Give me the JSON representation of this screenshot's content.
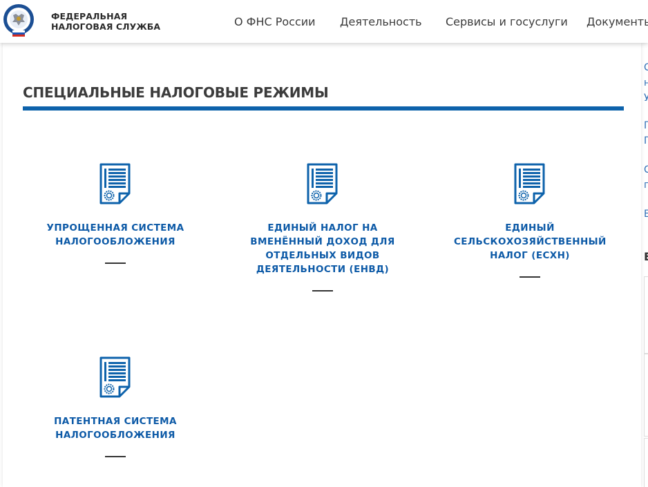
{
  "header": {
    "brand_line1": "ФЕДЕРАЛЬНАЯ",
    "brand_line2": "НАЛОГОВАЯ СЛУЖБА",
    "nav": [
      "О ФНС России",
      "Деятельность",
      "Сервисы и госуслуги",
      "Документы"
    ]
  },
  "main": {
    "title": "СПЕЦИАЛЬНЫЕ НАЛОГОВЫЕ РЕЖИМЫ",
    "cards": [
      {
        "label": "УПРОЩЕННАЯ СИСТЕМА НАЛОГООБЛОЖЕНИЯ"
      },
      {
        "label": "ЕДИНЫЙ НАЛОГ НА ВМЕНЁННЫЙ ДОХОД ДЛЯ ОТДЕЛЬНЫХ ВИДОВ ДЕЯТЕЛЬНОСТИ (ЕНВД)"
      },
      {
        "label": "ЕДИНЫЙ СЕЛЬСКОХОЗЯЙСТВЕННЫЙ НАЛОГ (ЕСХН)"
      },
      {
        "label": "ПАТЕНТНАЯ СИСТЕМА НАЛОГООБЛОЖЕНИЯ"
      }
    ]
  },
  "sidebar_fragments": [
    "С",
    "н",
    "У",
    "П",
    "П",
    "С",
    "п",
    "Е",
    "Е"
  ],
  "colors": {
    "accent": "#0d62ab",
    "link": "#0d5aa7"
  }
}
